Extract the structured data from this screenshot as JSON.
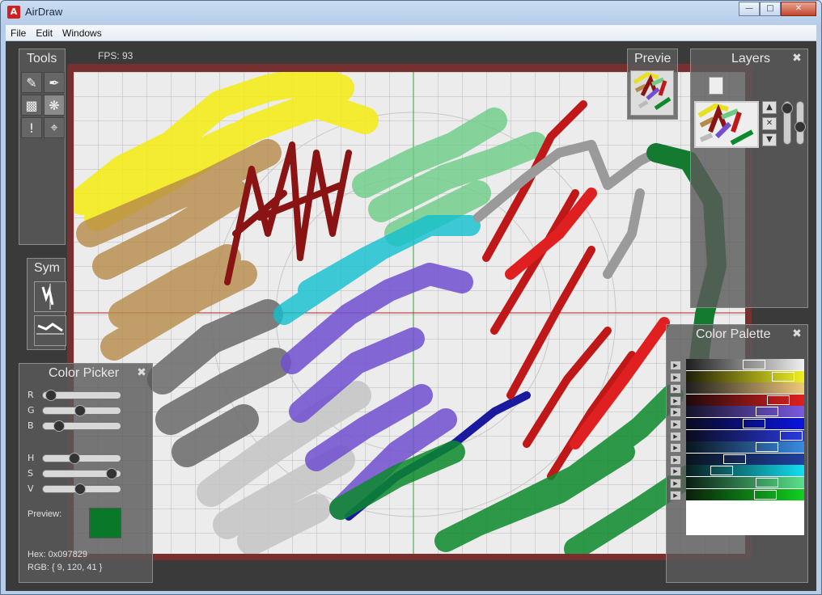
{
  "window": {
    "title": "AirDraw",
    "app_icon": "app-icon-letter-a"
  },
  "menu": {
    "items": [
      "File",
      "Edit",
      "Windows"
    ]
  },
  "status": {
    "fps": "FPS: 93"
  },
  "panels": {
    "tools": {
      "title": "Tools",
      "icons": [
        "pencil-icon",
        "marker-icon",
        "brush-icon",
        "feather-icon",
        "exclamation-icon",
        "select-icon"
      ]
    },
    "sym": {
      "title": "Sym"
    },
    "preview": {
      "title": "Previe"
    },
    "layers": {
      "title": "Layers"
    },
    "color_picker": {
      "title": "Color Picker",
      "sliders": [
        {
          "label": "R",
          "value": 0.04
        },
        {
          "label": "G",
          "value": 0.47
        },
        {
          "label": "B",
          "value": 0.16
        },
        {
          "label": "H",
          "value": 0.38
        },
        {
          "label": "S",
          "value": 0.93
        },
        {
          "label": "V",
          "value": 0.47
        }
      ],
      "preview_label": "Preview:",
      "hex": "Hex:  0x097829",
      "rgb": "RGB:  { 9, 120, 41 }",
      "color": "#097829"
    },
    "palette": {
      "title": "Color Palette",
      "rows": [
        {
          "from": "#1e1e1e",
          "to": "#f0f0f0"
        },
        {
          "from": "#1e1e0a",
          "to": "#f0f020"
        },
        {
          "from": "#1e1e1e",
          "to": "#f0c87a"
        },
        {
          "from": "#1e0a0a",
          "to": "#e02020"
        },
        {
          "from": "#141428",
          "to": "#7a5ae0"
        },
        {
          "from": "#0a0a1e",
          "to": "#0a14e0"
        },
        {
          "from": "#0a0a1e",
          "to": "#2a3ae0"
        },
        {
          "from": "#0a141e",
          "to": "#3a8ae0"
        },
        {
          "from": "#0a141e",
          "to": "#2040a0"
        },
        {
          "from": "#0a1e1e",
          "to": "#10e0f0"
        },
        {
          "from": "#0a1e14",
          "to": "#5ae08a"
        },
        {
          "from": "#0a1e0a",
          "to": "#10d020"
        }
      ]
    }
  }
}
